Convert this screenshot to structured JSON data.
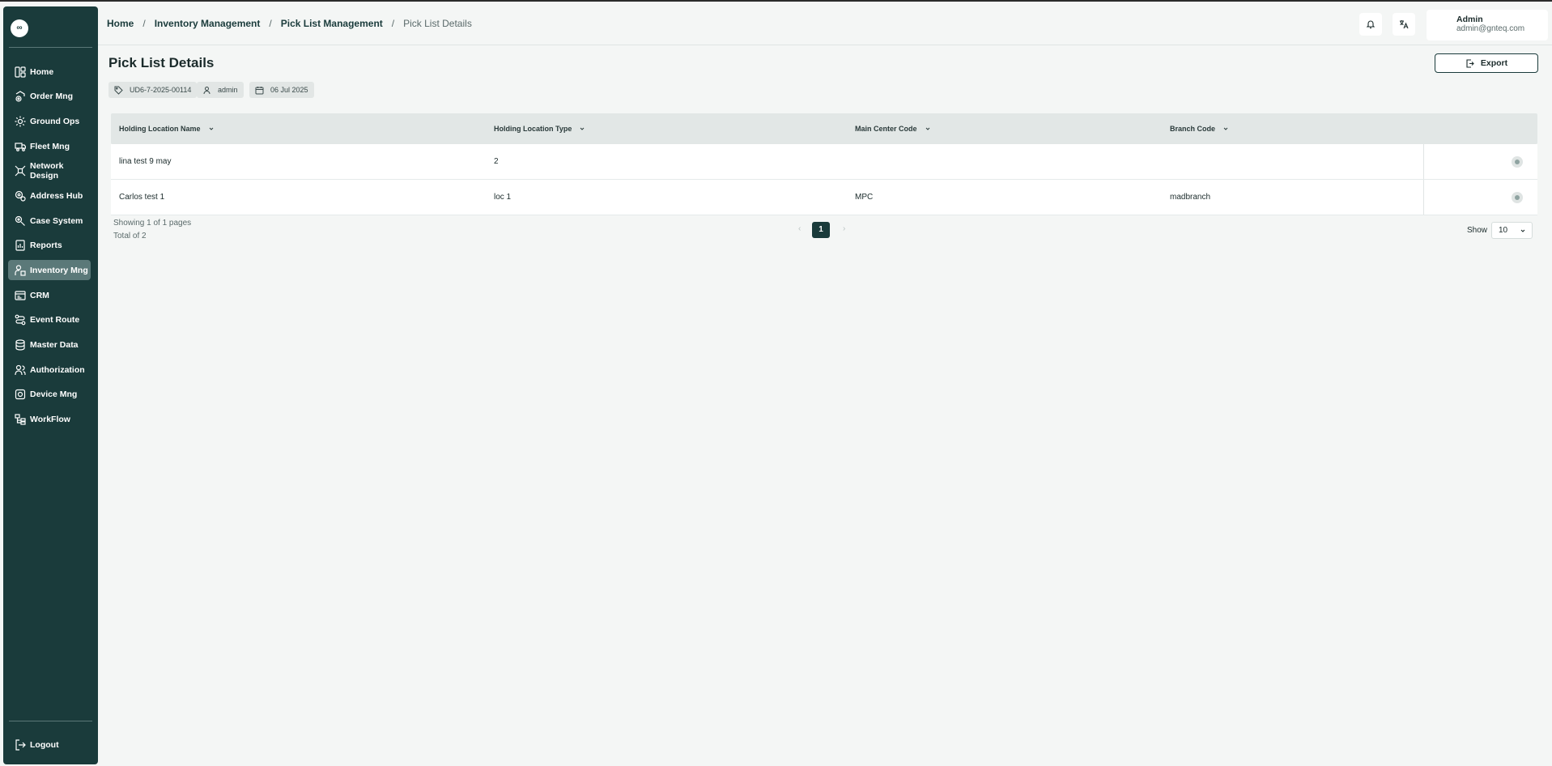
{
  "sidebar": {
    "logo_glyph": "∞",
    "items": [
      {
        "label": "Home",
        "icon": "layout-grid-icon"
      },
      {
        "label": "Order Mng",
        "icon": "order-gear-icon"
      },
      {
        "label": "Ground Ops",
        "icon": "sun-gear-icon"
      },
      {
        "label": "Fleet Mng",
        "icon": "truck-icon"
      },
      {
        "label": "Network Design",
        "icon": "network-icon"
      },
      {
        "label": "Address Hub",
        "icon": "map-pin-icon"
      },
      {
        "label": "Case System",
        "icon": "case-gear-icon"
      },
      {
        "label": "Reports",
        "icon": "report-icon"
      },
      {
        "label": "Inventory Mng",
        "icon": "inventory-icon"
      },
      {
        "label": "CRM",
        "icon": "crm-icon"
      },
      {
        "label": "Event Route",
        "icon": "route-icon"
      },
      {
        "label": "Master Data",
        "icon": "database-icon"
      },
      {
        "label": "Authorization",
        "icon": "users-icon"
      },
      {
        "label": "Device Mng",
        "icon": "device-gear-icon"
      },
      {
        "label": "WorkFlow",
        "icon": "workflow-icon"
      }
    ],
    "active_index": 8,
    "logout_label": "Logout"
  },
  "header": {
    "breadcrumb": [
      "Home",
      "Inventory Management",
      "Pick List Management"
    ],
    "breadcrumb_current": "Pick List Details",
    "breadcrumb_separator": "/",
    "user": {
      "name": "Admin",
      "email": "admin@gnteq.com"
    }
  },
  "page": {
    "title": "Pick List Details",
    "export_label": "Export",
    "chips": {
      "id": "UD6-7-2025-00114",
      "user": "admin",
      "date": "06 Jul 2025"
    }
  },
  "table": {
    "columns": [
      "Holding Location Name",
      "Holding Location Type",
      "Main Center Code",
      "Branch Code"
    ],
    "rows": [
      [
        "lina test 9 may",
        "2",
        "",
        ""
      ],
      [
        "Carlos test 1",
        "loc 1",
        "MPC",
        "madbranch"
      ]
    ]
  },
  "pagination": {
    "showing": "Showing 1 of 1 pages",
    "total": "Total of 2",
    "current_page": "1",
    "prev_glyph": "‹",
    "next_glyph": "›",
    "show_label": "Show",
    "page_size": "10"
  },
  "colors": {
    "sidebar_bg": "#1a3b3b",
    "active_item": "#5b7979",
    "page_bg": "#f4f6f5"
  }
}
